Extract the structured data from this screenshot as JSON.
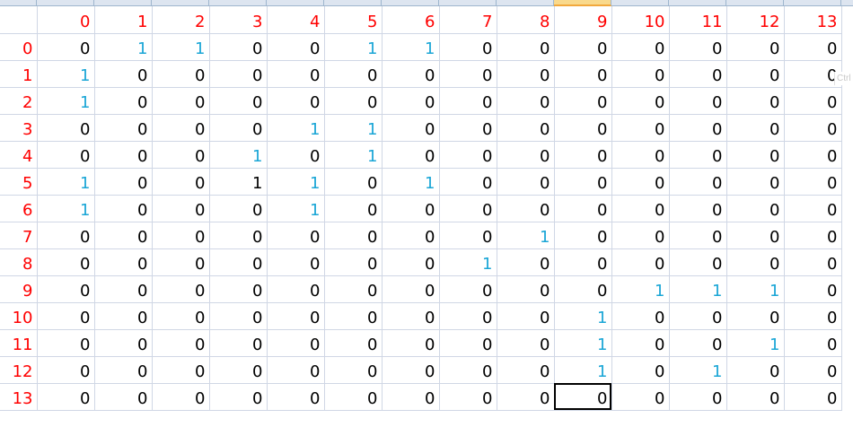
{
  "sheet": {
    "selected_column": 10,
    "active_cell": {
      "row": 14,
      "col": 10
    },
    "colors": {
      "header_text": "#ff0000",
      "highlight_text": "#1aa6d6",
      "normal_text": "#000000",
      "gridline": "#d0d7e5",
      "selected_header": "#f9d98c"
    },
    "rows": [
      [
        "",
        "0",
        "1",
        "2",
        "3",
        "4",
        "5",
        "6",
        "7",
        "8",
        "9",
        "10",
        "11",
        "12",
        "13"
      ],
      [
        "0",
        "0",
        "1",
        "1",
        "0",
        "0",
        "1",
        "1",
        "0",
        "0",
        "0",
        "0",
        "0",
        "0",
        "0"
      ],
      [
        "1",
        "1",
        "0",
        "0",
        "0",
        "0",
        "0",
        "0",
        "0",
        "0",
        "0",
        "0",
        "0",
        "0",
        "0"
      ],
      [
        "2",
        "1",
        "0",
        "0",
        "0",
        "0",
        "0",
        "0",
        "0",
        "0",
        "0",
        "0",
        "0",
        "0",
        "0"
      ],
      [
        "3",
        "0",
        "0",
        "0",
        "0",
        "1",
        "1",
        "0",
        "0",
        "0",
        "0",
        "0",
        "0",
        "0",
        "0"
      ],
      [
        "4",
        "0",
        "0",
        "0",
        "1",
        "0",
        "1",
        "0",
        "0",
        "0",
        "0",
        "0",
        "0",
        "0",
        "0"
      ],
      [
        "5",
        "1",
        "0",
        "0",
        "1",
        "1",
        "0",
        "1",
        "0",
        "0",
        "0",
        "0",
        "0",
        "0",
        "0"
      ],
      [
        "6",
        "1",
        "0",
        "0",
        "0",
        "1",
        "0",
        "0",
        "0",
        "0",
        "0",
        "0",
        "0",
        "0",
        "0"
      ],
      [
        "7",
        "0",
        "0",
        "0",
        "0",
        "0",
        "0",
        "0",
        "0",
        "1",
        "0",
        "0",
        "0",
        "0",
        "0"
      ],
      [
        "8",
        "0",
        "0",
        "0",
        "0",
        "0",
        "0",
        "0",
        "1",
        "0",
        "0",
        "0",
        "0",
        "0",
        "0"
      ],
      [
        "9",
        "0",
        "0",
        "0",
        "0",
        "0",
        "0",
        "0",
        "0",
        "0",
        "0",
        "1",
        "1",
        "1",
        "0"
      ],
      [
        "10",
        "0",
        "0",
        "0",
        "0",
        "0",
        "0",
        "0",
        "0",
        "0",
        "1",
        "0",
        "0",
        "0",
        "0"
      ],
      [
        "11",
        "0",
        "0",
        "0",
        "0",
        "0",
        "0",
        "0",
        "0",
        "0",
        "1",
        "0",
        "0",
        "1",
        "0"
      ],
      [
        "12",
        "0",
        "0",
        "0",
        "0",
        "0",
        "0",
        "0",
        "0",
        "0",
        "1",
        "0",
        "1",
        "0",
        "0"
      ],
      [
        "13",
        "0",
        "0",
        "0",
        "0",
        "0",
        "0",
        "0",
        "0",
        "0",
        "0",
        "0",
        "0",
        "0",
        "0"
      ]
    ],
    "highlight": [
      [
        0,
        0,
        0,
        0,
        0,
        0,
        0,
        0,
        0,
        0,
        0,
        0,
        0,
        0,
        0
      ],
      [
        0,
        0,
        1,
        1,
        0,
        0,
        1,
        1,
        0,
        0,
        0,
        0,
        0,
        0,
        0
      ],
      [
        0,
        1,
        0,
        0,
        0,
        0,
        0,
        0,
        0,
        0,
        0,
        0,
        0,
        0,
        0
      ],
      [
        0,
        1,
        0,
        0,
        0,
        0,
        0,
        0,
        0,
        0,
        0,
        0,
        0,
        0,
        0
      ],
      [
        0,
        0,
        0,
        0,
        0,
        1,
        1,
        0,
        0,
        0,
        0,
        0,
        0,
        0,
        0
      ],
      [
        0,
        0,
        0,
        0,
        1,
        0,
        1,
        0,
        0,
        0,
        0,
        0,
        0,
        0,
        0
      ],
      [
        0,
        1,
        0,
        0,
        0,
        1,
        0,
        1,
        0,
        0,
        0,
        0,
        0,
        0,
        0
      ],
      [
        0,
        1,
        0,
        0,
        0,
        1,
        0,
        0,
        0,
        0,
        0,
        0,
        0,
        0,
        0
      ],
      [
        0,
        0,
        0,
        0,
        0,
        0,
        0,
        0,
        0,
        1,
        0,
        0,
        0,
        0,
        0
      ],
      [
        0,
        0,
        0,
        0,
        0,
        0,
        0,
        0,
        1,
        0,
        0,
        0,
        0,
        0,
        0
      ],
      [
        0,
        0,
        0,
        0,
        0,
        0,
        0,
        0,
        0,
        0,
        0,
        1,
        1,
        1,
        0
      ],
      [
        0,
        0,
        0,
        0,
        0,
        0,
        0,
        0,
        0,
        0,
        1,
        0,
        0,
        0,
        0
      ],
      [
        0,
        0,
        0,
        0,
        0,
        0,
        0,
        0,
        0,
        0,
        1,
        0,
        0,
        1,
        0
      ],
      [
        0,
        0,
        0,
        0,
        0,
        0,
        0,
        0,
        0,
        0,
        1,
        0,
        1,
        0,
        0
      ],
      [
        0,
        0,
        0,
        0,
        0,
        0,
        0,
        0,
        0,
        0,
        0,
        0,
        0,
        0,
        0
      ]
    ],
    "paste_options_hint": "Ctrl"
  }
}
